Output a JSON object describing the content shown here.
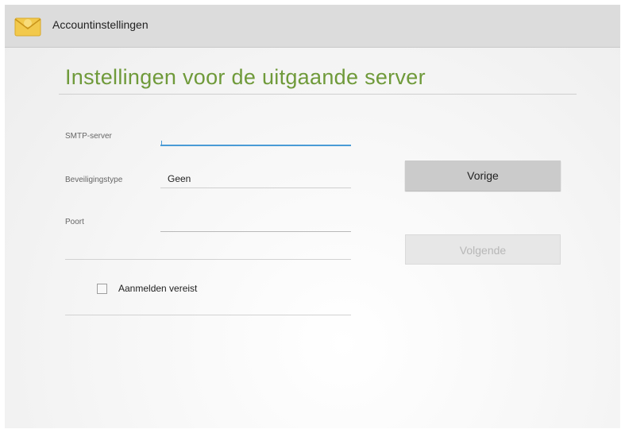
{
  "actionbar": {
    "title": "Accountinstellingen",
    "icon": "email-app-icon"
  },
  "heading": "Instellingen voor de uitgaande server",
  "form": {
    "smtp": {
      "label": "SMTP-server",
      "value": ""
    },
    "security": {
      "label": "Beveiligingstype",
      "value": "Geen"
    },
    "port": {
      "label": "Poort",
      "value": ""
    },
    "auth": {
      "label": "Aanmelden vereist",
      "checked": false
    }
  },
  "buttons": {
    "previous": "Vorige",
    "next": "Volgende"
  },
  "colors": {
    "heading": "#6f9a3a",
    "focus": "#4a9bd6",
    "actionbar": "#dcdcdc"
  }
}
